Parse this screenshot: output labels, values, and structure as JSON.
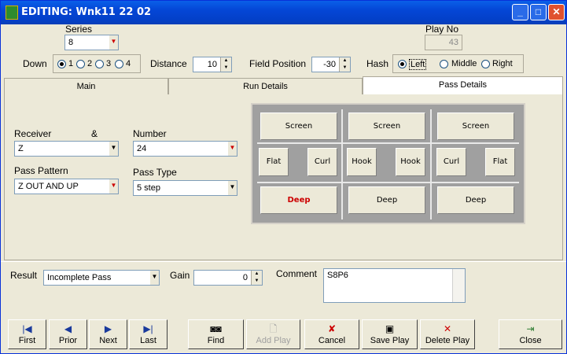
{
  "window": {
    "title": "EDITING: Wnk11 22 02"
  },
  "header": {
    "series_label": "Series",
    "series_value": "8",
    "play_no_label": "Play No",
    "play_no_value": "43",
    "down_label": "Down",
    "down_options": [
      "1",
      "2",
      "3",
      "4"
    ],
    "down_selected": "1",
    "distance_label": "Distance",
    "distance_value": "10",
    "field_position_label": "Field Position",
    "field_position_value": "-30",
    "hash_label": "Hash",
    "hash_options": [
      "Left",
      "Middle",
      "Right"
    ],
    "hash_selected": "Left"
  },
  "tabs": [
    {
      "label": "Main",
      "active": false
    },
    {
      "label": "Run Details",
      "active": false
    },
    {
      "label": "Pass Details",
      "active": true
    }
  ],
  "pass_details": {
    "receiver_label": "Receiver",
    "amp": "&",
    "receiver_value": "Z",
    "number_label": "Number",
    "number_value": "24",
    "pass_pattern_label": "Pass Pattern",
    "pass_pattern_value": "Z OUT AND UP",
    "pass_type_label": "Pass Type",
    "pass_type_value": "5 step",
    "routes": {
      "row1": [
        "Screen",
        "Screen",
        "Screen"
      ],
      "row2": [
        "Flat",
        "Curl",
        "Hook",
        "Hook",
        "Curl",
        "Flat"
      ],
      "row3": [
        "Deep",
        "Deep",
        "Deep"
      ],
      "selected_color": "#cc0000"
    }
  },
  "result": {
    "result_label": "Result",
    "result_value": "Incomplete Pass",
    "gain_label": "Gain",
    "gain_value": "0",
    "comment_label": "Comment",
    "comment_value": "S8P6"
  },
  "buttons": {
    "first": "First",
    "prior": "Prior",
    "next": "Next",
    "last": "Last",
    "find": "Find",
    "add_play": "Add Play",
    "cancel": "Cancel",
    "save_play": "Save Play",
    "delete_play": "Delete Play",
    "close": "Close"
  }
}
